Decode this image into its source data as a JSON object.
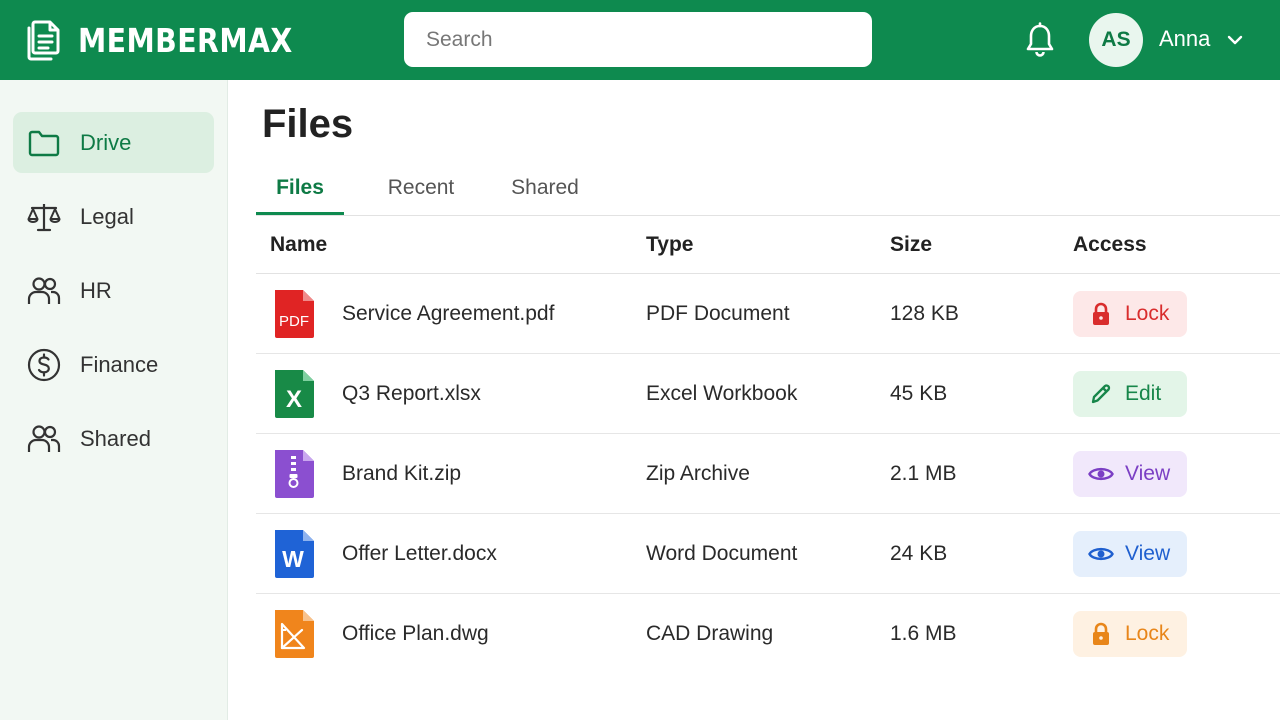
{
  "header": {
    "brand": "MEMBERMAX",
    "brand_icon": "document-stack-icon",
    "search_placeholder": "Search",
    "avatar_initials": "AS",
    "user_name": "Anna"
  },
  "sidebar": {
    "items": [
      {
        "label": "Drive",
        "icon": "folder-icon",
        "active": true
      },
      {
        "label": "Legal",
        "icon": "scales-icon",
        "active": false
      },
      {
        "label": "HR",
        "icon": "people-icon",
        "active": false
      },
      {
        "label": "Finance",
        "icon": "dollar-circle-icon",
        "active": false
      },
      {
        "label": "Shared",
        "icon": "people-icon",
        "active": false
      }
    ]
  },
  "main": {
    "title": "Files",
    "tabs": [
      {
        "label": "Files",
        "active": true
      },
      {
        "label": "Recent",
        "active": false
      },
      {
        "label": "Shared",
        "active": false
      }
    ],
    "columns": {
      "name": "Name",
      "type": "Type",
      "size": "Size",
      "access": "Access"
    },
    "files": [
      {
        "name": "Service Agreement.pdf",
        "type": "PDF Document",
        "size": "128 KB",
        "icon_text": "PDF",
        "icon": "pdf-file-icon",
        "color": "#e02424",
        "access": {
          "label": "Lock",
          "icon": "lock-icon",
          "fg": "#d92d2d",
          "bg": "#fde8e8"
        }
      },
      {
        "name": "Q3 Report.xlsx",
        "type": "Excel Workbook",
        "size": "45 KB",
        "icon_text": "X",
        "icon": "excel-file-icon",
        "color": "#188a47",
        "access": {
          "label": "Edit",
          "icon": "pencil-icon",
          "fg": "#17864a",
          "bg": "#e3f5e8"
        }
      },
      {
        "name": "Brand Kit.zip",
        "type": "Zip Archive",
        "size": "2.1 MB",
        "icon_text": "",
        "icon": "zip-file-icon",
        "color": "#8b4fd0",
        "access": {
          "label": "View",
          "icon": "eye-icon",
          "fg": "#7b3fc4",
          "bg": "#f1e8fb"
        }
      },
      {
        "name": "Offer Letter.docx",
        "type": "Word Document",
        "size": "24 KB",
        "icon_text": "W",
        "icon": "word-file-icon",
        "color": "#1f63d6",
        "access": {
          "label": "View",
          "icon": "eye-icon",
          "fg": "#1f5fcf",
          "bg": "#e5effc"
        }
      },
      {
        "name": "Office Plan.dwg",
        "type": "CAD Drawing",
        "size": "1.6 MB",
        "icon_text": "",
        "icon": "cad-file-icon",
        "color": "#f0851c",
        "access": {
          "label": "Lock",
          "icon": "lock-icon",
          "fg": "#e8861a",
          "bg": "#fef1e2"
        }
      }
    ]
  },
  "colors": {
    "brand_green": "#0e8a4f",
    "sidebar_bg": "#f2f8f3",
    "active_bg": "#dcefe1"
  }
}
